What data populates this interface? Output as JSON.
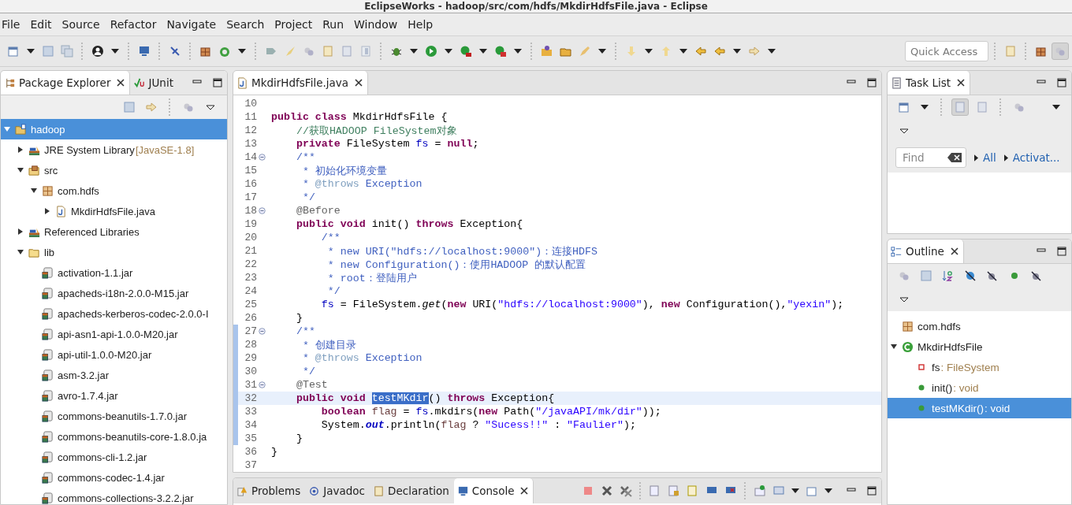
{
  "window": {
    "title": "EclipseWorks - hadoop/src/com/hdfs/MkdirHdfsFile.java - Eclipse"
  },
  "menu": [
    "File",
    "Edit",
    "Source",
    "Refactor",
    "Navigate",
    "Search",
    "Project",
    "Run",
    "Window",
    "Help"
  ],
  "quick_access": {
    "placeholder": "Quick Access"
  },
  "explorer": {
    "tabs": [
      {
        "label": "Package Explorer",
        "selected": true
      },
      {
        "label": "JUnit",
        "selected": false
      }
    ],
    "tree": [
      {
        "kind": "project",
        "label": "hadoop",
        "expanded": true,
        "selected": true,
        "children": [
          {
            "kind": "library",
            "label": "JRE System Library",
            "decoration": "[JavaSE-1.8]",
            "expanded": false,
            "selected": false
          },
          {
            "kind": "srcfolder",
            "label": "src",
            "expanded": true,
            "selected": false,
            "children": [
              {
                "kind": "package",
                "label": "com.hdfs",
                "expanded": true,
                "selected": false,
                "children": [
                  {
                    "kind": "javafile",
                    "label": "MkdirHdfsFile.java",
                    "expanded": false,
                    "selected": false
                  }
                ]
              }
            ]
          },
          {
            "kind": "library",
            "label": "Referenced Libraries",
            "expanded": false,
            "selected": false
          },
          {
            "kind": "folder",
            "label": "lib",
            "expanded": true,
            "selected": false,
            "children": [
              {
                "kind": "jar",
                "label": "activation-1.1.jar",
                "selected": false
              },
              {
                "kind": "jar",
                "label": "apacheds-i18n-2.0.0-M15.jar",
                "selected": false
              },
              {
                "kind": "jar",
                "label": "apacheds-kerberos-codec-2.0.0-I",
                "selected": false
              },
              {
                "kind": "jar",
                "label": "api-asn1-api-1.0.0-M20.jar",
                "selected": false
              },
              {
                "kind": "jar",
                "label": "api-util-1.0.0-M20.jar",
                "selected": false
              },
              {
                "kind": "jar",
                "label": "asm-3.2.jar",
                "selected": false
              },
              {
                "kind": "jar",
                "label": "avro-1.7.4.jar",
                "selected": false
              },
              {
                "kind": "jar",
                "label": "commons-beanutils-1.7.0.jar",
                "selected": false
              },
              {
                "kind": "jar",
                "label": "commons-beanutils-core-1.8.0.ja",
                "selected": false
              },
              {
                "kind": "jar",
                "label": "commons-cli-1.2.jar",
                "selected": false
              },
              {
                "kind": "jar",
                "label": "commons-codec-1.4.jar",
                "selected": false
              },
              {
                "kind": "jar",
                "label": "commons-collections-3.2.2.jar",
                "selected": false
              }
            ]
          }
        ]
      }
    ]
  },
  "editor": {
    "tabs": [
      {
        "label": "MkdirHdfsFile.java",
        "selected": true
      }
    ],
    "lines": [
      {
        "number": "10",
        "fold": false,
        "current": false,
        "changed": false
      },
      {
        "number": "11",
        "fold": false,
        "current": false,
        "changed": false,
        "tokens": [
          {
            "kind": "kw",
            "text": "public class "
          },
          {
            "kind": "plain",
            "text": "MkdirHdfsFile {"
          }
        ]
      },
      {
        "number": "12",
        "fold": false,
        "current": false,
        "changed": false,
        "tokens": [
          {
            "kind": "comment",
            "text": "    //获取HADOOP FileSystem对象"
          }
        ]
      },
      {
        "number": "13",
        "fold": false,
        "current": false,
        "changed": false,
        "tokens": [
          {
            "kind": "kw",
            "text": "    private "
          },
          {
            "kind": "plain",
            "text": "FileSystem "
          },
          {
            "kind": "field",
            "text": "fs"
          },
          {
            "kind": "plain",
            "text": " = "
          },
          {
            "kind": "kw",
            "text": "null"
          },
          {
            "kind": "plain",
            "text": ";"
          }
        ]
      },
      {
        "number": "14",
        "fold": true,
        "current": false,
        "changed": false,
        "tokens": [
          {
            "kind": "javadoc",
            "text": "    /**"
          }
        ]
      },
      {
        "number": "15",
        "fold": false,
        "current": false,
        "changed": false,
        "tokens": [
          {
            "kind": "javadoc",
            "text": "     * 初始化环境变量"
          }
        ]
      },
      {
        "number": "16",
        "fold": false,
        "current": false,
        "changed": false,
        "tokens": [
          {
            "kind": "javadoc",
            "text": "     * "
          },
          {
            "kind": "doctag",
            "text": "@throws"
          },
          {
            "kind": "javadoc",
            "text": " Exception"
          }
        ]
      },
      {
        "number": "17",
        "fold": false,
        "current": false,
        "changed": false,
        "tokens": [
          {
            "kind": "javadoc",
            "text": "     */"
          }
        ]
      },
      {
        "number": "18",
        "fold": true,
        "current": false,
        "changed": false,
        "tokens": [
          {
            "kind": "annotation",
            "text": "    @Before"
          }
        ]
      },
      {
        "number": "19",
        "fold": false,
        "current": false,
        "changed": false,
        "tokens": [
          {
            "kind": "kw",
            "text": "    public void "
          },
          {
            "kind": "plain",
            "text": "init() "
          },
          {
            "kind": "kw",
            "text": "throws "
          },
          {
            "kind": "plain",
            "text": "Exception{"
          }
        ]
      },
      {
        "number": "20",
        "fold": false,
        "current": false,
        "changed": false,
        "tokens": [
          {
            "kind": "javadoc",
            "text": "        /**"
          }
        ]
      },
      {
        "number": "21",
        "fold": false,
        "current": false,
        "changed": false,
        "tokens": [
          {
            "kind": "javadoc",
            "text": "         * new URI(\"hdfs://localhost:9000\")：连接HDFS"
          }
        ]
      },
      {
        "number": "22",
        "fold": false,
        "current": false,
        "changed": false,
        "tokens": [
          {
            "kind": "javadoc",
            "text": "         * new Configuration()：使用HADOOP 的默认配置"
          }
        ]
      },
      {
        "number": "23",
        "fold": false,
        "current": false,
        "changed": false,
        "tokens": [
          {
            "kind": "javadoc",
            "text": "         * root：登陆用户"
          }
        ]
      },
      {
        "number": "24",
        "fold": false,
        "current": false,
        "changed": false,
        "tokens": [
          {
            "kind": "javadoc",
            "text": "         */"
          }
        ]
      },
      {
        "number": "25",
        "fold": false,
        "current": false,
        "changed": false,
        "tokens": [
          {
            "kind": "field",
            "text": "        fs"
          },
          {
            "kind": "plain",
            "text": " = FileSystem."
          },
          {
            "kind": "static",
            "text": "get"
          },
          {
            "kind": "plain",
            "text": "("
          },
          {
            "kind": "kw",
            "text": "new "
          },
          {
            "kind": "plain",
            "text": "URI("
          },
          {
            "kind": "string",
            "text": "\"hdfs://localhost:9000\""
          },
          {
            "kind": "plain",
            "text": "), "
          },
          {
            "kind": "kw",
            "text": "new "
          },
          {
            "kind": "plain",
            "text": "Configuration(),"
          },
          {
            "kind": "string",
            "text": "\"yexin\""
          },
          {
            "kind": "plain",
            "text": ");"
          }
        ]
      },
      {
        "number": "26",
        "fold": false,
        "current": false,
        "changed": false,
        "tokens": [
          {
            "kind": "plain",
            "text": "    }"
          }
        ]
      },
      {
        "number": "27",
        "fold": true,
        "current": false,
        "changed": true,
        "tokens": [
          {
            "kind": "javadoc",
            "text": "    /**"
          }
        ]
      },
      {
        "number": "28",
        "fold": false,
        "current": false,
        "changed": true,
        "tokens": [
          {
            "kind": "javadoc",
            "text": "     * 创建目录"
          }
        ]
      },
      {
        "number": "29",
        "fold": false,
        "current": false,
        "changed": true,
        "tokens": [
          {
            "kind": "javadoc",
            "text": "     * "
          },
          {
            "kind": "doctag",
            "text": "@throws"
          },
          {
            "kind": "javadoc",
            "text": " Exception"
          }
        ]
      },
      {
        "number": "30",
        "fold": false,
        "current": false,
        "changed": true,
        "tokens": [
          {
            "kind": "javadoc",
            "text": "     */"
          }
        ]
      },
      {
        "number": "31",
        "fold": true,
        "current": false,
        "changed": true,
        "tokens": [
          {
            "kind": "annotation",
            "text": "    @Test"
          }
        ]
      },
      {
        "number": "32",
        "fold": false,
        "current": true,
        "changed": true,
        "tokens": [
          {
            "kind": "kw",
            "text": "    public void "
          },
          {
            "kind": "selected",
            "text": "testMKdir"
          },
          {
            "kind": "plain",
            "text": "() "
          },
          {
            "kind": "kw",
            "text": "throws "
          },
          {
            "kind": "plain",
            "text": "Exception{"
          }
        ]
      },
      {
        "number": "33",
        "fold": false,
        "current": false,
        "changed": true,
        "tokens": [
          {
            "kind": "kw",
            "text": "        boolean "
          },
          {
            "kind": "local",
            "text": "flag"
          },
          {
            "kind": "plain",
            "text": " = "
          },
          {
            "kind": "field",
            "text": "fs"
          },
          {
            "kind": "plain",
            "text": ".mkdirs("
          },
          {
            "kind": "kw",
            "text": "new "
          },
          {
            "kind": "plain",
            "text": "Path("
          },
          {
            "kind": "string",
            "text": "\"/javaAPI/mk/dir\""
          },
          {
            "kind": "plain",
            "text": "));"
          }
        ]
      },
      {
        "number": "34",
        "fold": false,
        "current": false,
        "changed": true,
        "tokens": [
          {
            "kind": "plain",
            "text": "        System."
          },
          {
            "kind": "staticfield",
            "text": "out"
          },
          {
            "kind": "plain",
            "text": ".println("
          },
          {
            "kind": "local",
            "text": "flag"
          },
          {
            "kind": "plain",
            "text": " ? "
          },
          {
            "kind": "string",
            "text": "\"Sucess!!\""
          },
          {
            "kind": "plain",
            "text": " : "
          },
          {
            "kind": "string",
            "text": "\"Faulier\""
          },
          {
            "kind": "plain",
            "text": ");"
          }
        ]
      },
      {
        "number": "35",
        "fold": false,
        "current": false,
        "changed": true,
        "tokens": [
          {
            "kind": "plain",
            "text": "    }"
          }
        ]
      },
      {
        "number": "36",
        "fold": false,
        "current": false,
        "changed": false,
        "tokens": [
          {
            "kind": "plain",
            "text": "}"
          }
        ]
      },
      {
        "number": "37",
        "fold": false,
        "current": false,
        "changed": false
      }
    ]
  },
  "task_list": {
    "tabs": [
      {
        "label": "Task List",
        "selected": true
      }
    ],
    "find": {
      "placeholder": "Find"
    },
    "links": [
      "All",
      "Activat..."
    ]
  },
  "outline": {
    "tabs": [
      {
        "label": "Outline",
        "selected": true
      }
    ],
    "tree": [
      {
        "kind": "package",
        "label": "com.hdfs",
        "selected": false
      },
      {
        "kind": "class",
        "label": "MkdirHdfsFile",
        "expanded": true,
        "selected": false,
        "children": [
          {
            "kind": "field",
            "label": "fs",
            "detail": " : FileSystem",
            "selected": false
          },
          {
            "kind": "method",
            "label": "init()",
            "detail": " : void",
            "selected": false
          },
          {
            "kind": "method",
            "label": "testMKdir()",
            "detail": " : void",
            "selected": true
          }
        ]
      }
    ]
  },
  "bottom_panel": {
    "tabs": [
      {
        "label": "Problems",
        "selected": false
      },
      {
        "label": "Javadoc",
        "selected": false
      },
      {
        "label": "Declaration",
        "selected": false
      },
      {
        "label": "Console",
        "selected": true
      }
    ]
  }
}
